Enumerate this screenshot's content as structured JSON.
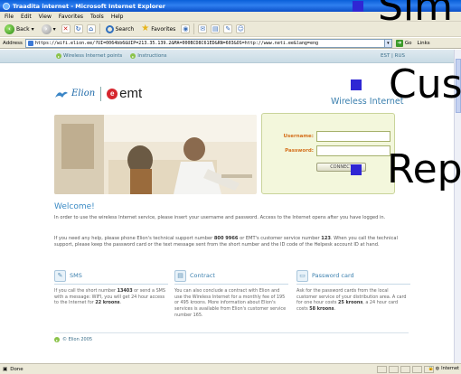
{
  "window": {
    "title": "Traadita internet - Microsoft Internet Explorer"
  },
  "menu": [
    "File",
    "Edit",
    "View",
    "Favorites",
    "Tools",
    "Help"
  ],
  "toolbar": {
    "back_label": "Back",
    "search_label": "Search",
    "favorites_label": "Favorites"
  },
  "address": {
    "label": "Address",
    "url": "https://wifi.elion.ee/?UI=0064bb6&UIP=213.35.139.2&MA=000BCD8C61ED&RN=603&OS=http://www.neti.ee&lang=eng",
    "go_label": "Go",
    "links_label": "Links"
  },
  "page": {
    "nav": {
      "points_label": "Wireless Internet points",
      "instructions_label": "Instructions",
      "lang_label": "EST | RUS"
    },
    "logos": {
      "elion": "Elion",
      "emt": "emt",
      "emt_mark": "e"
    },
    "service_title": "Wireless Internet",
    "login": {
      "username_label": "Username:",
      "password_label": "Password:",
      "connect_label": "CONNECT"
    },
    "welcome": "Welcome!",
    "intro": "In order to use the wireless Internet service, please insert your username and password. Access to the Internet opens after you have logged in.",
    "help_pre": "If you need any help, please phone Elion's technical support number ",
    "help_num1": "800 9966",
    "help_mid": " or EMT's customer service number ",
    "help_num2": "123",
    "help_post": ". When you call the technical support, please keep the password card or the text message sent from the short number and the ID code of the Helpesk account ID at hand.",
    "sms": {
      "title": "SMS",
      "text_pre": "If you call the short number ",
      "text_num": "13403",
      "text_mid": " or send a SMS with a message: WIFI, you will get 24 hour access to the Internet for ",
      "text_price": "22 kroons",
      "text_end": "."
    },
    "contract": {
      "title": "Contract",
      "text": "You can also conclude a contract with Elion and use the Wireless Internet for a monthly fee of 195 or 495 kroons. More information about Elion's services is available from Elion's customer service number 165."
    },
    "card": {
      "title": "Password card",
      "text_pre": "Ask for the password cards from the local customer service of your distribution area. A card for one hour costs ",
      "price1": "25 kroons",
      "text_mid": ", a 24 hour card costs ",
      "price2": "58 kroons",
      "text_end": "."
    },
    "copyright": "© Elion 2005"
  },
  "status": {
    "text": "Done",
    "zone": "Internet"
  },
  "slide": {
    "line1": "Sim",
    "line2": "Cus",
    "line3": "Rep"
  },
  "colors": {
    "accent_blue": "#3a8ac4",
    "label_orange": "#d46f1b",
    "bullet": "#2f26d4",
    "ie_title": "#0a5fd8"
  }
}
